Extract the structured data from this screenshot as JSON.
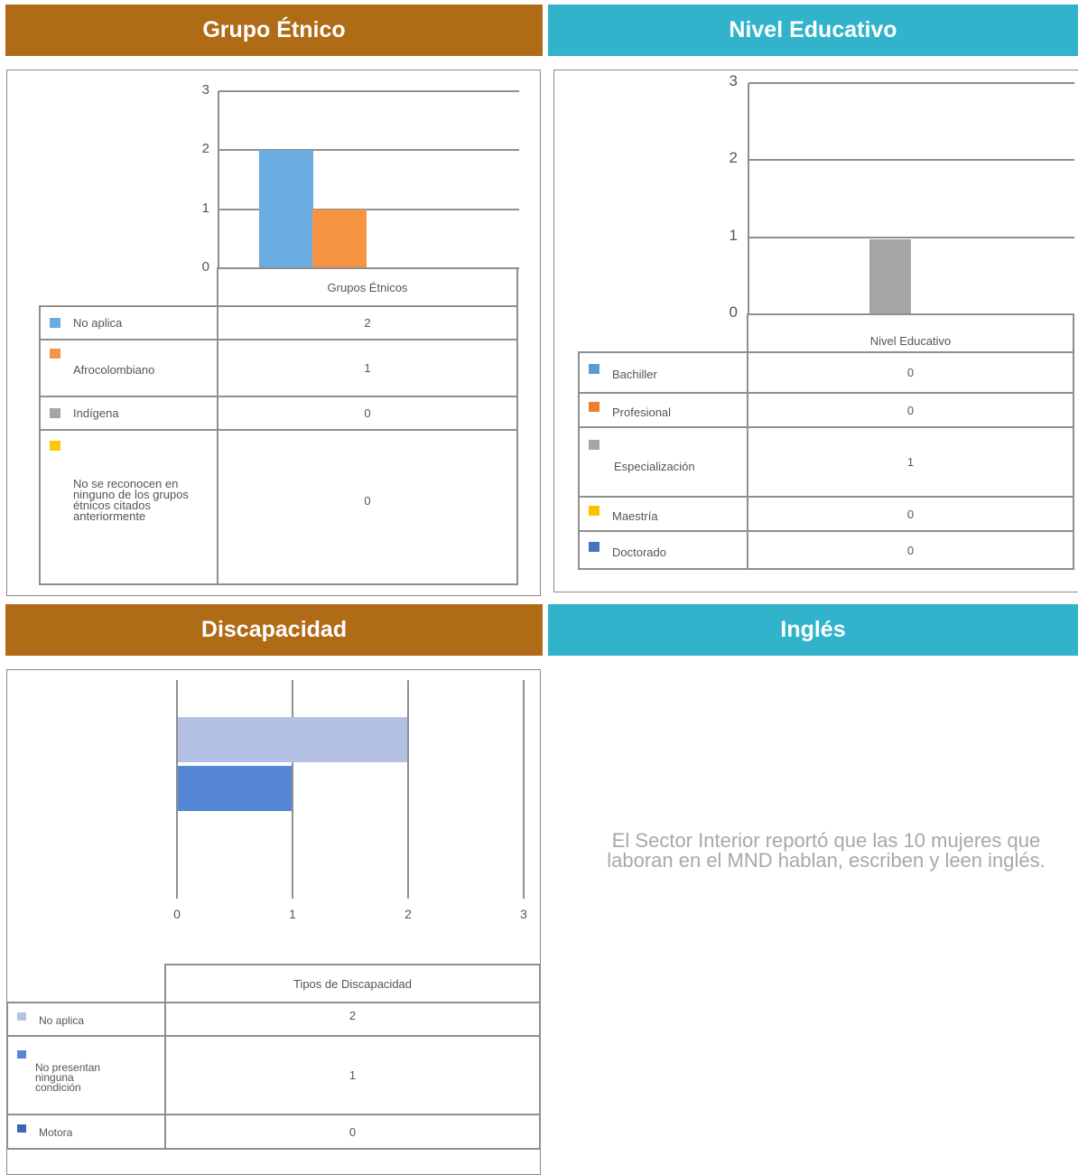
{
  "headers": {
    "etnico": "Grupo Étnico",
    "educativo": "Nivel Educativo",
    "discapacidad": "Discapacidad",
    "ingles": "Inglés"
  },
  "colors": {
    "header_brown": "#b06b17",
    "header_teal": "#31b3cb"
  },
  "chart_data": [
    {
      "type": "bar",
      "id": "etnico",
      "categories": [
        "Grupos Étnicos"
      ],
      "xlabel": "Grupos Étnicos",
      "ylim": [
        0,
        3
      ],
      "yticks": [
        "0",
        "1",
        "2",
        "3"
      ],
      "grid": true,
      "series": [
        {
          "name": "No aplica",
          "values": [
            2
          ],
          "color": "#6aace0"
        },
        {
          "name": "Afrocolombiano",
          "values": [
            1
          ],
          "color": "#f59442"
        },
        {
          "name": "Indígena",
          "values": [
            0
          ],
          "color": "#a5a5a5"
        },
        {
          "name": "No se reconocen en ninguno de los grupos étnicos citados anteriormente",
          "values": [
            0
          ],
          "color": "#fec900"
        }
      ],
      "table": [
        {
          "label": "No aplica",
          "value": "2"
        },
        {
          "label": "Afrocolombiano",
          "value": "1"
        },
        {
          "label": "Indígena",
          "value": "0"
        },
        {
          "label": "No se reconocen en ninguno de los grupos étnicos citados anteriormente",
          "value": "0"
        }
      ]
    },
    {
      "type": "bar",
      "id": "educativo",
      "categories": [
        "Nivel Educativo"
      ],
      "xlabel": "Nivel Educativo",
      "ylim": [
        0,
        3
      ],
      "yticks": [
        "0",
        "1",
        "2",
        "3"
      ],
      "grid": true,
      "series": [
        {
          "name": "Bachiller",
          "values": [
            0
          ],
          "color": "#5b9bd5"
        },
        {
          "name": "Profesional",
          "values": [
            0
          ],
          "color": "#ed7d31"
        },
        {
          "name": "Especialización",
          "values": [
            1
          ],
          "color": "#a5a5a5"
        },
        {
          "name": "Maestría",
          "values": [
            0
          ],
          "color": "#ffc000"
        },
        {
          "name": "Doctorado",
          "values": [
            0
          ],
          "color": "#4472c4"
        }
      ],
      "table": [
        {
          "label": "Bachiller",
          "value": "0"
        },
        {
          "label": "Profesional",
          "value": "0"
        },
        {
          "label": "Especialización",
          "value": "1"
        },
        {
          "label": "Maestría",
          "value": "0"
        },
        {
          "label": "Doctorado",
          "value": "0"
        }
      ]
    },
    {
      "type": "bar",
      "id": "discapacidad",
      "orientation": "horizontal",
      "categories": [
        "Tipos de Discapacidad"
      ],
      "xlabel": "Tipos de Discapacidad",
      "xlim": [
        0,
        3
      ],
      "xticks": [
        "0",
        "1",
        "2",
        "3"
      ],
      "grid": true,
      "series": [
        {
          "name": "No aplica",
          "values": [
            2
          ],
          "color": "#b4c1e4"
        },
        {
          "name": "No presentan ninguna condición",
          "values": [
            1
          ],
          "color": "#5686d6"
        },
        {
          "name": "Motora",
          "values": [
            0
          ],
          "color": "#3a66b4"
        }
      ],
      "table": [
        {
          "label": "No aplica",
          "value": "2"
        },
        {
          "label": "No presentan ninguna condición",
          "value": "1"
        },
        {
          "label": "Motora",
          "value": "0"
        }
      ]
    }
  ],
  "ingles_text": "El Sector Interior reportó que las 10 mujeres que laboran en el MND hablan, escriben y leen  inglés."
}
